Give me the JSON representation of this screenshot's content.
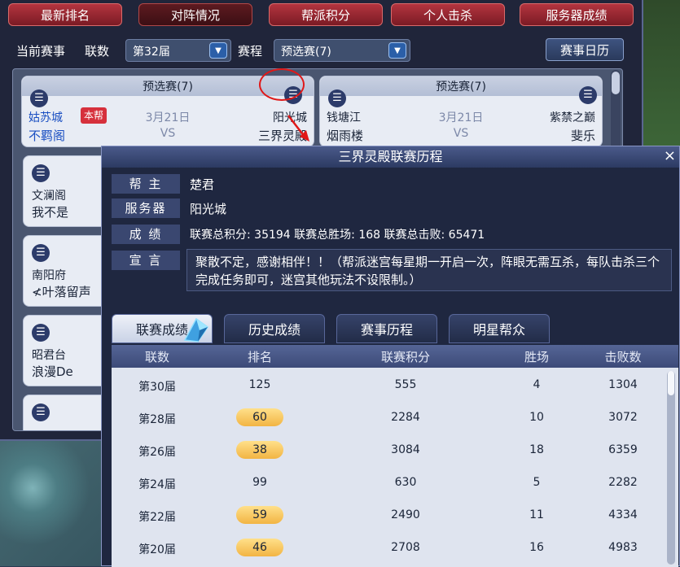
{
  "tabs": [
    "最新排名",
    "对阵情况",
    "帮派积分",
    "个人击杀",
    "服务器成绩"
  ],
  "filters": {
    "current_label": "当前赛事",
    "session_label": "联数",
    "session_value": "第32届",
    "schedule_label": "赛程",
    "schedule_value": "预选赛(7)",
    "calendar_button": "赛事日历"
  },
  "matches": [
    {
      "stage": "预选赛(7)",
      "date": "3月21日",
      "vs": "VS",
      "left_server": "姑苏城",
      "left_guild": "不羁阁",
      "home_badge": "本帮",
      "right_server": "阳光城",
      "right_guild": "三界灵殿"
    },
    {
      "stage": "预选赛(7)",
      "date": "3月21日",
      "vs": "VS",
      "left_server": "钱塘江",
      "left_guild": "烟雨楼",
      "right_server": "紫禁之巅",
      "right_guild": "斐乐"
    }
  ],
  "side_matches": [
    {
      "server": "文澜阁",
      "guild": "我不是"
    },
    {
      "server": "南阳府",
      "guild": "≮叶落留声"
    },
    {
      "server": "昭君台",
      "guild": "浪漫De"
    }
  ],
  "popup": {
    "title": "三界灵殿联赛历程",
    "close": "×",
    "leader_label": "帮 主",
    "leader_value": "楚君",
    "server_label": "服务器",
    "server_value": "阳光城",
    "result_label": "成 绩",
    "result_value": "联赛总积分: 35194  联赛总胜场: 168  联赛总击败: 65471",
    "motto_label": "宣 言",
    "motto_value": "聚散不定，感谢相伴！！（帮派迷宫每星期一开启一次，阵眼无需互杀，每队击杀三个完成任务即可，迷宫其他玩法不设限制。）",
    "subtabs": [
      "联赛成绩",
      "历史成绩",
      "赛事历程",
      "明星帮众"
    ],
    "columns": [
      "联数",
      "排名",
      "联赛积分",
      "胜场",
      "击败数"
    ],
    "rows": [
      {
        "session": "第30届",
        "rank": "125",
        "highlight": false,
        "points": "555",
        "wins": "4",
        "kills": "1304"
      },
      {
        "session": "第28届",
        "rank": "60",
        "highlight": true,
        "points": "2284",
        "wins": "10",
        "kills": "3072"
      },
      {
        "session": "第26届",
        "rank": "38",
        "highlight": true,
        "points": "3084",
        "wins": "18",
        "kills": "6359"
      },
      {
        "session": "第24届",
        "rank": "99",
        "highlight": false,
        "points": "630",
        "wins": "5",
        "kills": "2282"
      },
      {
        "session": "第22届",
        "rank": "59",
        "highlight": true,
        "points": "2490",
        "wins": "11",
        "kills": "4334"
      },
      {
        "session": "第20届",
        "rank": "46",
        "highlight": true,
        "points": "2708",
        "wins": "16",
        "kills": "4983"
      }
    ]
  },
  "colors": {
    "accent_red": "#e01818",
    "badge_gold": "#f2b443",
    "link_blue": "#1a4fc2"
  }
}
